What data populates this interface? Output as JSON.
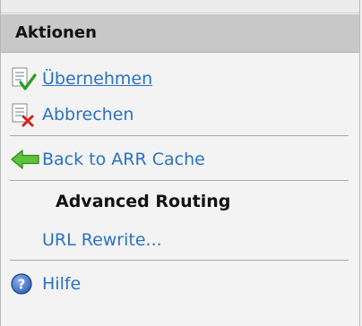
{
  "panel": {
    "title": "Aktionen"
  },
  "actions": {
    "apply_label": "Übernehmen",
    "cancel_label": "Abbrechen",
    "back_label": "Back to ARR Cache",
    "section_heading": "Advanced Routing",
    "url_rewrite_label": "URL Rewrite...",
    "help_label": "Hilfe"
  },
  "icons": {
    "apply": "document-check-icon",
    "cancel": "document-cross-icon",
    "back": "green-back-arrow-icon",
    "help": "help-question-icon"
  },
  "colors": {
    "link": "#2a72c4",
    "header_bg": "#c8c8c8",
    "pane_bg": "#f3f3f3"
  }
}
